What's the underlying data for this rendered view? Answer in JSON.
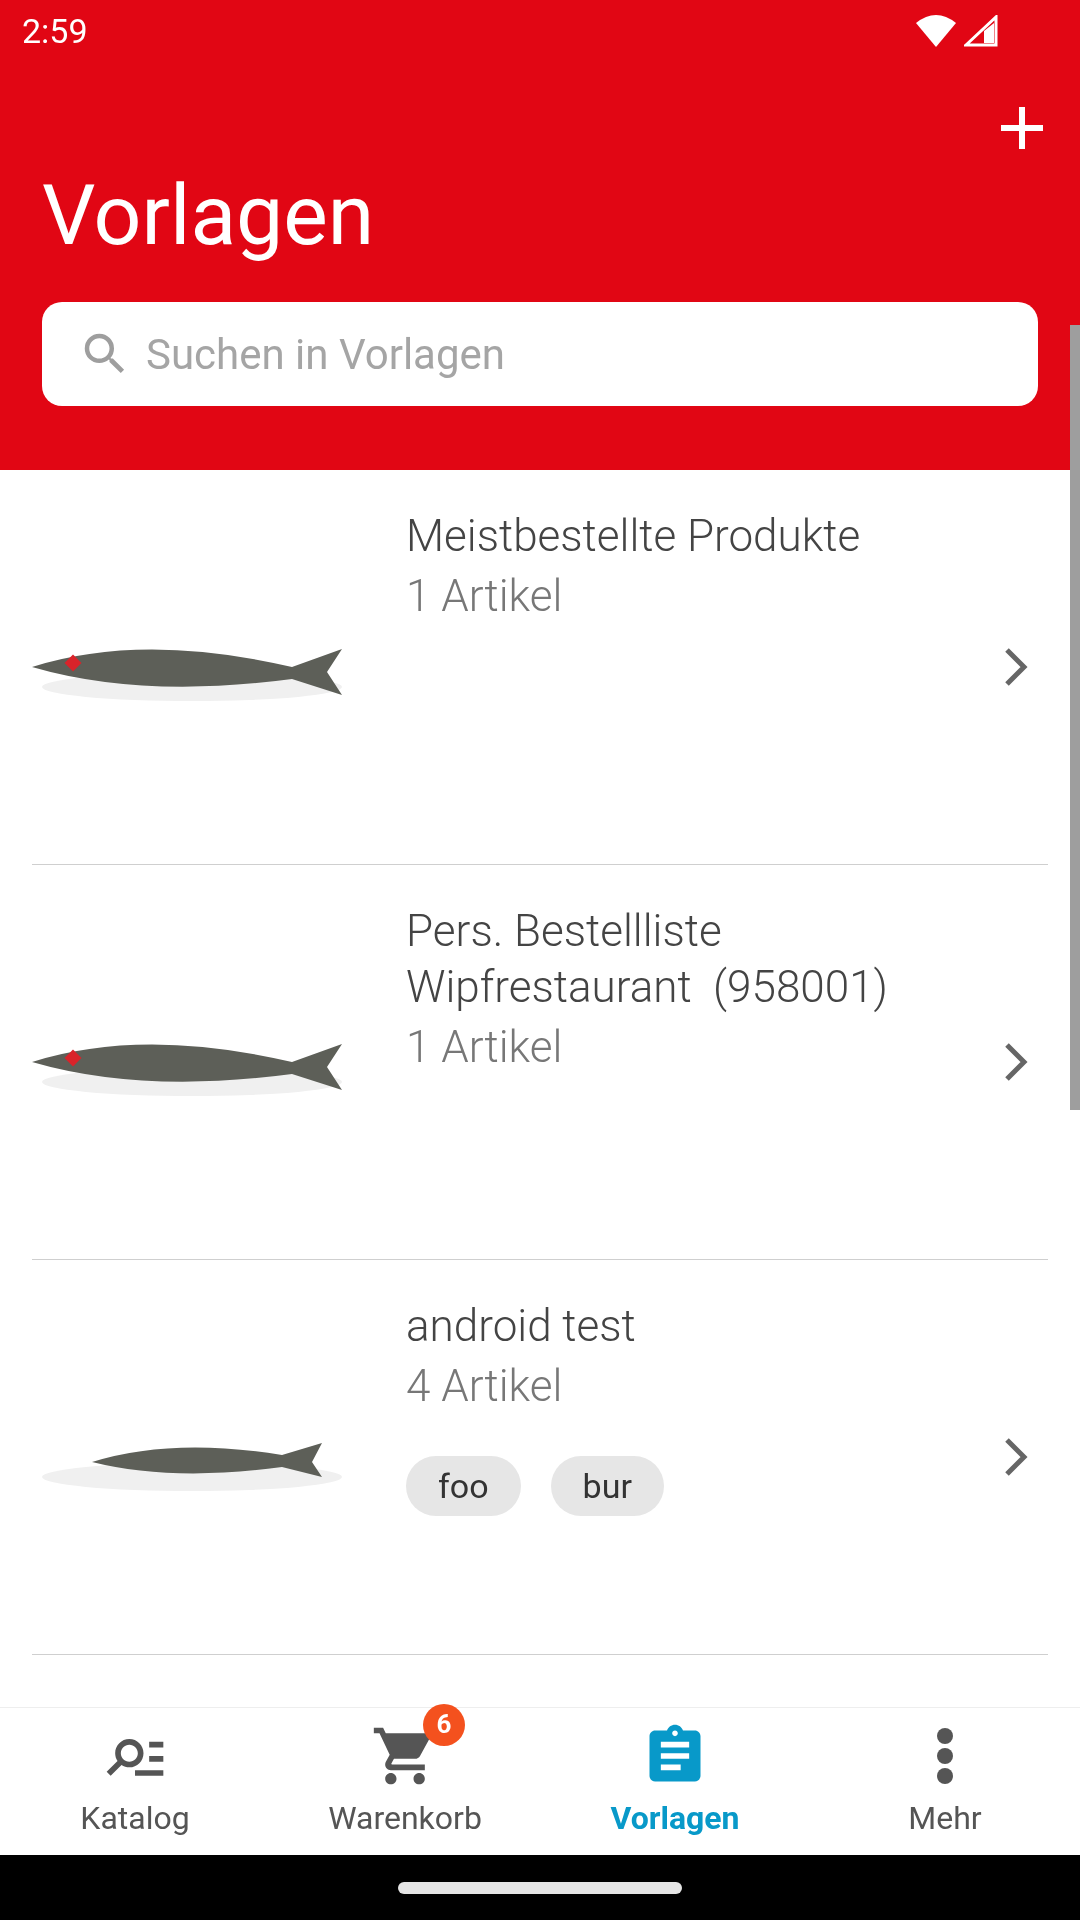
{
  "status_bar": {
    "time": "2:59"
  },
  "header": {
    "title": "Vorlagen",
    "search": {
      "placeholder": "Suchen in Vorlagen"
    }
  },
  "templates": [
    {
      "title": "Meistbestellte Produkte",
      "count": "1 Artikel"
    },
    {
      "title": "Pers. Bestellliste Wipfrestaurant  (958001)",
      "count": "1 Artikel"
    },
    {
      "title": "android test",
      "count": "4 Artikel",
      "tags": [
        "foo",
        "bur"
      ]
    }
  ],
  "bottom_nav": [
    {
      "kind": "catalog",
      "label": "Katalog",
      "selected": false
    },
    {
      "kind": "cart",
      "label": "Warenkorb",
      "selected": false,
      "badge": "6"
    },
    {
      "kind": "templates",
      "label": "Vorlagen",
      "selected": true
    },
    {
      "kind": "more",
      "label": "Mehr",
      "selected": false
    }
  ]
}
